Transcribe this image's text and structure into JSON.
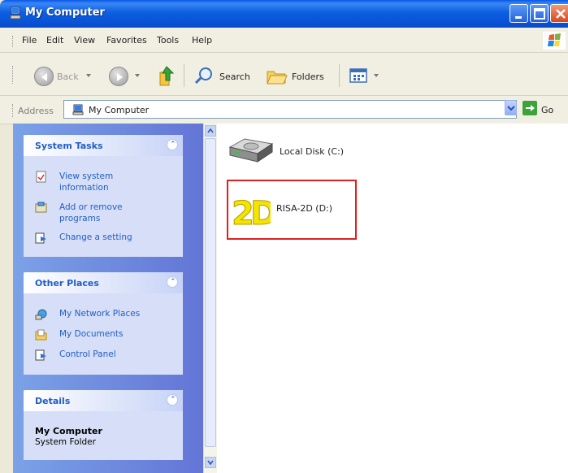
{
  "window": {
    "title": "My Computer"
  },
  "menu": [
    "File",
    "Edit",
    "View",
    "Favorites",
    "Tools",
    "Help"
  ],
  "toolbar": {
    "back": "Back",
    "search": "Search",
    "folders": "Folders"
  },
  "address": {
    "label": "Address",
    "value": "My Computer",
    "go": "Go"
  },
  "system_tasks": {
    "title": "System Tasks",
    "items": [
      "View system information",
      "Add or remove programs",
      "Change a setting"
    ],
    "lines": [
      [
        "View system",
        "information"
      ],
      [
        "Add or remove",
        "programs"
      ],
      [
        "Change a setting"
      ]
    ]
  },
  "other_places": {
    "title": "Other Places",
    "items": [
      "My Network Places",
      "My Documents",
      "Control Panel"
    ]
  },
  "details": {
    "title": "Details",
    "name": "My Computer",
    "type": "System Folder"
  },
  "drives": [
    {
      "label": "Local Disk (C:)",
      "icon": "hard-disk-icon"
    },
    {
      "label": "RISA-2D (D:)",
      "icon": "risa-2d-cd-icon",
      "highlighted": true
    }
  ],
  "colors": {
    "titlebar": "#0a58e6",
    "taskpane": "#6375d6",
    "panel_title": "#215dc6",
    "highlight": "#e02020"
  }
}
